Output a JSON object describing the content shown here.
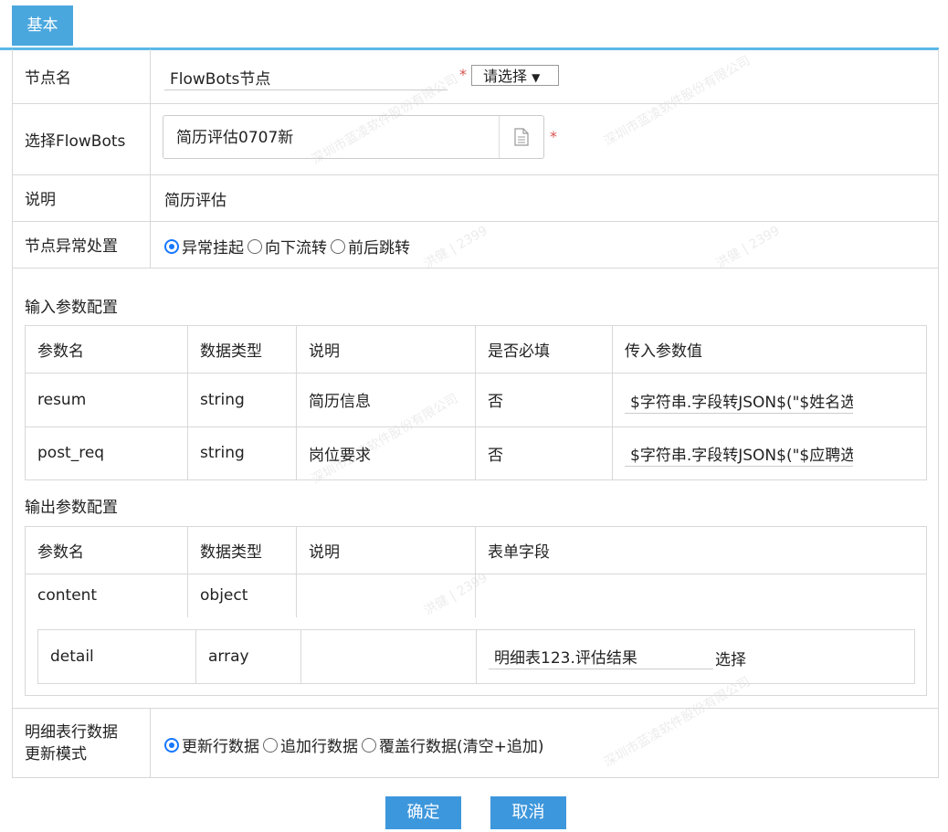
{
  "tab": {
    "label": "基本"
  },
  "fields": {
    "node_name": {
      "label": "节点名",
      "value": "FlowBots节点",
      "required": "*",
      "select": "请选择"
    },
    "flowbots": {
      "label": "选择FlowBots",
      "value": "简历评估0707新",
      "required": "*"
    },
    "desc": {
      "label": "说明",
      "value": "简历评估"
    },
    "exception": {
      "label": "节点异常处置",
      "options": [
        "异常挂起",
        "向下流转",
        "前后跳转"
      ],
      "selected": "异常挂起"
    }
  },
  "input_section": {
    "title": "输入参数配置",
    "headers": [
      "参数名",
      "数据类型",
      "说明",
      "是否必填",
      "传入参数值"
    ],
    "rows": [
      {
        "name": "resum",
        "type": "string",
        "desc": "简历信息",
        "required": "否",
        "value": "$字符串.字段转JSON$(\"$姓名选择"
      },
      {
        "name": "post_req",
        "type": "string",
        "desc": "岗位要求",
        "required": "否",
        "value": "$字符串.字段转JSON$(\"$应聘选择"
      }
    ]
  },
  "output_section": {
    "title": "输出参数配置",
    "headers": [
      "参数名",
      "数据类型",
      "说明",
      "表单字段"
    ],
    "rows": [
      {
        "name": "content",
        "type": "object",
        "desc": "",
        "field": ""
      }
    ],
    "detail": {
      "name": "detail",
      "type": "array",
      "desc": "",
      "field": "明细表123.评估结果",
      "select": "选择"
    }
  },
  "update_mode": {
    "label1": "明细表行数据",
    "label2": "更新模式",
    "options": [
      "更新行数据",
      "追加行数据",
      "覆盖行数据(清空+追加)"
    ],
    "selected": "更新行数据"
  },
  "buttons": {
    "ok": "确定",
    "cancel": "取消"
  },
  "watermark": {
    "company": "深圳市蓝凌软件股份有限公司",
    "user": "洪健 | 2399"
  },
  "colors": {
    "accent": "#4aa7de",
    "button": "#3d97dc",
    "radio": "#1677ff",
    "required": "#d9534f"
  }
}
